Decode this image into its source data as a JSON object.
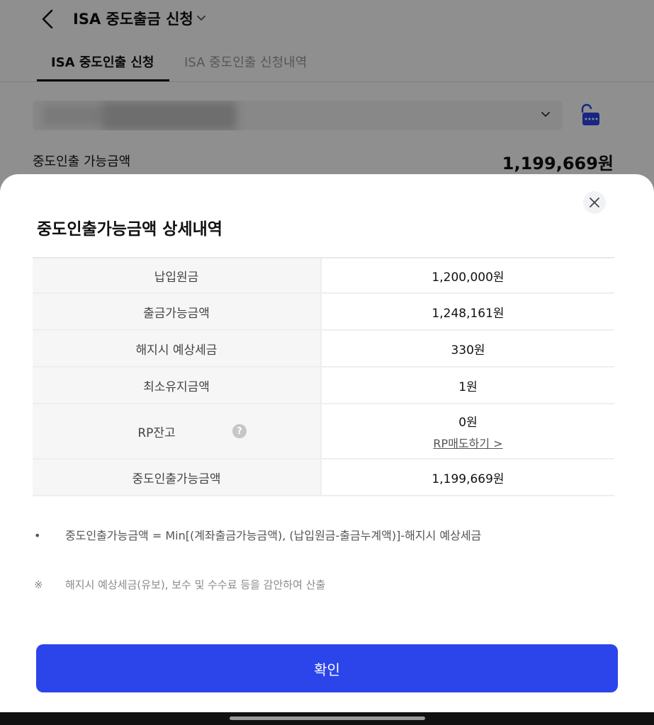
{
  "header": {
    "title": "ISA 중도출금 신청"
  },
  "tabs": [
    {
      "label": "ISA 중도인출 신청",
      "active": true
    },
    {
      "label": "ISA 중도인출 신청내역",
      "active": false
    }
  ],
  "account": {
    "available_label": "중도인출 가능금액",
    "available_value": "1,199,669원"
  },
  "sheet": {
    "title": "중도인출가능금액 상세내역",
    "rows": [
      {
        "label": "납입원금",
        "value": "1,200,000원"
      },
      {
        "label": "출금가능금액",
        "value": "1,248,161원"
      },
      {
        "label": "해지시 예상세금",
        "value": "330원"
      },
      {
        "label": "최소유지금액",
        "value": "1원"
      },
      {
        "label": "RP잔고",
        "value": "0원",
        "help_icon": "?",
        "link": "RP매도하기 >"
      },
      {
        "label": "중도인출가능금액",
        "value": "1,199,669원"
      }
    ],
    "notes": [
      {
        "bullet": "•",
        "text": "중도인출가능금액 = Min[(계좌출금가능금액), (납입원금-출금누계액)]-해지시 예상세금"
      },
      {
        "bullet": "※",
        "text": "해지시 예상세금(유보), 보수 및 수수료 등을 감안하여 산출"
      }
    ],
    "confirm_label": "확인"
  },
  "colors": {
    "primary": "#2b45ea",
    "accent_lock": "#2b45ea"
  },
  "icons": [
    "back-icon",
    "chevron-down-icon",
    "lock-icon",
    "close-icon",
    "help-icon"
  ]
}
